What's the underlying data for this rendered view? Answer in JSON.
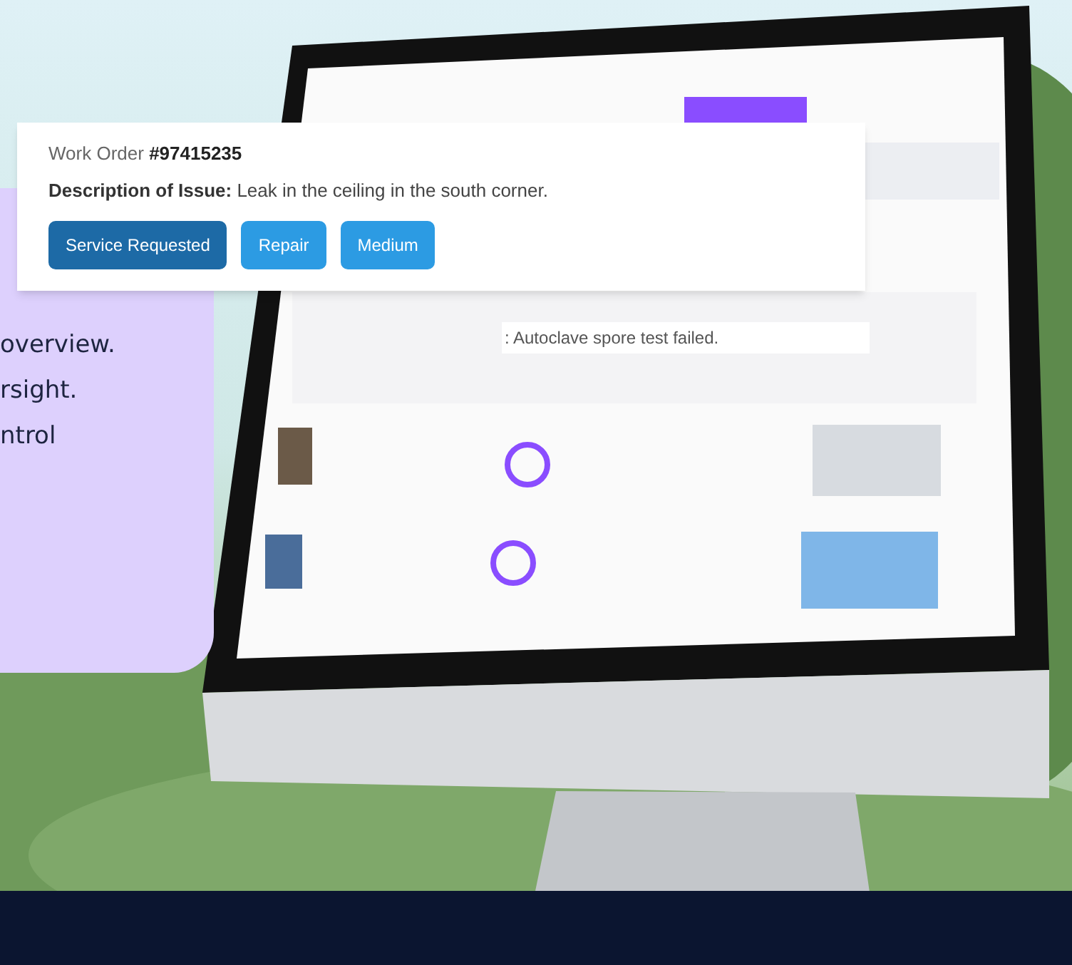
{
  "work_order": {
    "title": "Work Order **#97415235**",
    "description": "**Description of Issue:** Leak in the ceiling in the south corner.",
    "tags": [
      {
        "label": "Service Requested",
        "kind": "status"
      },
      {
        "label": "Repair",
        "kind": "category"
      },
      {
        "label": "Medium",
        "kind": "priority"
      }
    ]
  },
  "feature_lines": [
    "overview.",
    "rsight.",
    "ntrol"
  ],
  "alert": {
    "text": ": Autoclave spore test failed."
  }
}
